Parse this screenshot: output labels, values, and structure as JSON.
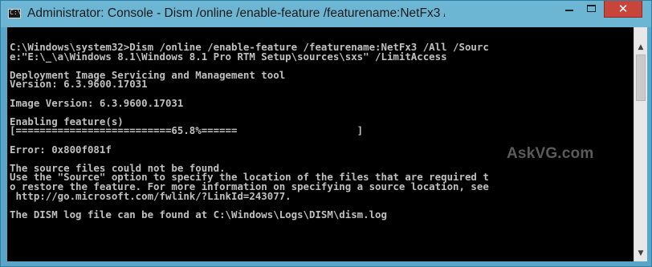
{
  "window": {
    "title": "Administrator: Console - Dism  /online /enable-feature /featurename:NetFx3 /A...",
    "app_icon_text": "C:\\",
    "buttons": {
      "minimize": "minimize",
      "maximize": "maximize",
      "close": "✕"
    }
  },
  "console": {
    "lines": [
      "C:\\Windows\\system32>Dism /online /enable-feature /featurename:NetFx3 /All /Sourc",
      "e:\"E:\\_\\a\\Windows 8.1\\Windows 8.1 Pro RTM Setup\\sources\\sxs\" /LimitAccess",
      "",
      "Deployment Image Servicing and Management tool",
      "Version: 6.3.9600.17031",
      "",
      "Image Version: 6.3.9600.17031",
      "",
      "Enabling feature(s)",
      "[==========================65.8%======                    ]",
      "",
      "Error: 0x800f081f",
      "",
      "The source files could not be found.",
      "Use the \"Source\" option to specify the location of the files that are required t",
      "o restore the feature. For more information on specifying a source location, see",
      " http://go.microsoft.com/fwlink/?LinkId=243077.",
      "",
      "The DISM log file can be found at C:\\Windows\\Logs\\DISM\\dism.log"
    ],
    "progress_percent": 65.8
  },
  "watermark": "AskVG.com",
  "scrollbar": {
    "up_arrow": "▲",
    "down_arrow": "▼"
  },
  "colors": {
    "console_bg": "#000000",
    "console_text": "#c0c0c0",
    "titlebar": "#6cb6d4",
    "close_button": "#c7453a"
  }
}
